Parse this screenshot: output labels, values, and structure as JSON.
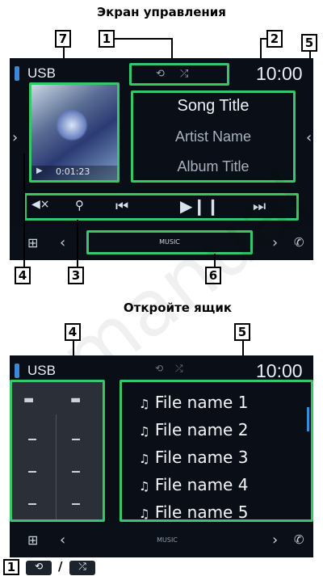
{
  "control_screen": {
    "caption": "Экран управления",
    "source": "USB",
    "clock": "10:00",
    "song_title": "Song Title",
    "artist_name": "Artist Name",
    "album_title": "Album Title",
    "elapsed_time": "0:01:23",
    "status_icons": [
      "repeat-icon",
      "shuffle-icon"
    ],
    "transport_icons": [
      "mute-icon",
      "search-icon",
      "previous-icon",
      "play-pause-icon",
      "next-icon"
    ],
    "nav_label": "MUSIC",
    "callouts": {
      "n1": "1",
      "n2": "2",
      "n3": "3",
      "n4": "4",
      "n5": "5",
      "n6": "6",
      "n7": "7"
    }
  },
  "drawer_screen": {
    "caption": "Откройте ящик",
    "source": "USB",
    "clock": "10:00",
    "files": [
      "File name 1",
      "File name 2",
      "File name 3",
      "File name 4",
      "File name 5"
    ],
    "nav_label": "MUSIC",
    "callouts": {
      "n4": "4",
      "n5": "5"
    }
  },
  "legend": {
    "number": "1",
    "separator": "/",
    "icons": [
      "repeat-icon",
      "shuffle-icon"
    ]
  },
  "colors": {
    "highlight_green": "#35c76a",
    "screen_bg": "#0a0e16",
    "accent_blue": "#2f8fd8"
  },
  "watermark_text": "manual"
}
